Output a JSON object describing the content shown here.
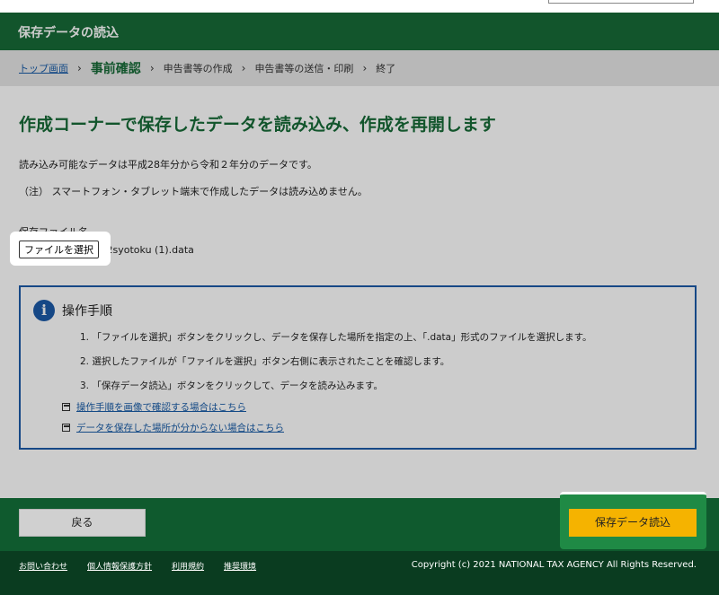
{
  "header": {
    "title": "保存データの読込"
  },
  "breadcrumb": {
    "items": [
      "トップ画面",
      "事前確認",
      "申告書等の作成",
      "申告書等の送信・印刷",
      "終了"
    ],
    "separator": "›"
  },
  "main": {
    "heading": "作成コーナーで保存したデータを読み込み、作成を再開します",
    "desc1": "読み込み可能なデータは平成28年分から令和２年分のデータです。",
    "desc2": "（注） スマートフォン・タブレット端末で作成したデータは読み込めません。",
    "file_label": "保存ファイル名",
    "file_button": "ファイルを選択",
    "file_name": "r2syotoku (1).data"
  },
  "info": {
    "icon_glyph": "i",
    "title": "操作手順",
    "steps": [
      "1. 「ファイルを選択」ボタンをクリックし、データを保存した場所を指定の上、「.data」形式のファイルを選択します。",
      "2. 選択したファイルが「ファイルを選択」ボタン右側に表示されたことを確認します。",
      "3. 「保存データ読込」ボタンをクリックして、データを読み込みます。"
    ],
    "links": [
      "操作手順を画像で確認する場合はこちら",
      "データを保存した場所が分からない場合はこちら"
    ]
  },
  "footer": {
    "back_button": "戻る",
    "load_button": "保存データ読込",
    "links": [
      "お問い合わせ",
      "個人情報保護方針",
      "利用規約",
      "推奨環境"
    ],
    "copyright": "Copyright (c) 2021 NATIONAL TAX AGENCY All Rights Reserved."
  },
  "colors": {
    "green": "#176b37",
    "dark_green": "#0a3c20",
    "blue": "#1c5aa8",
    "yellow": "#f5b300"
  }
}
